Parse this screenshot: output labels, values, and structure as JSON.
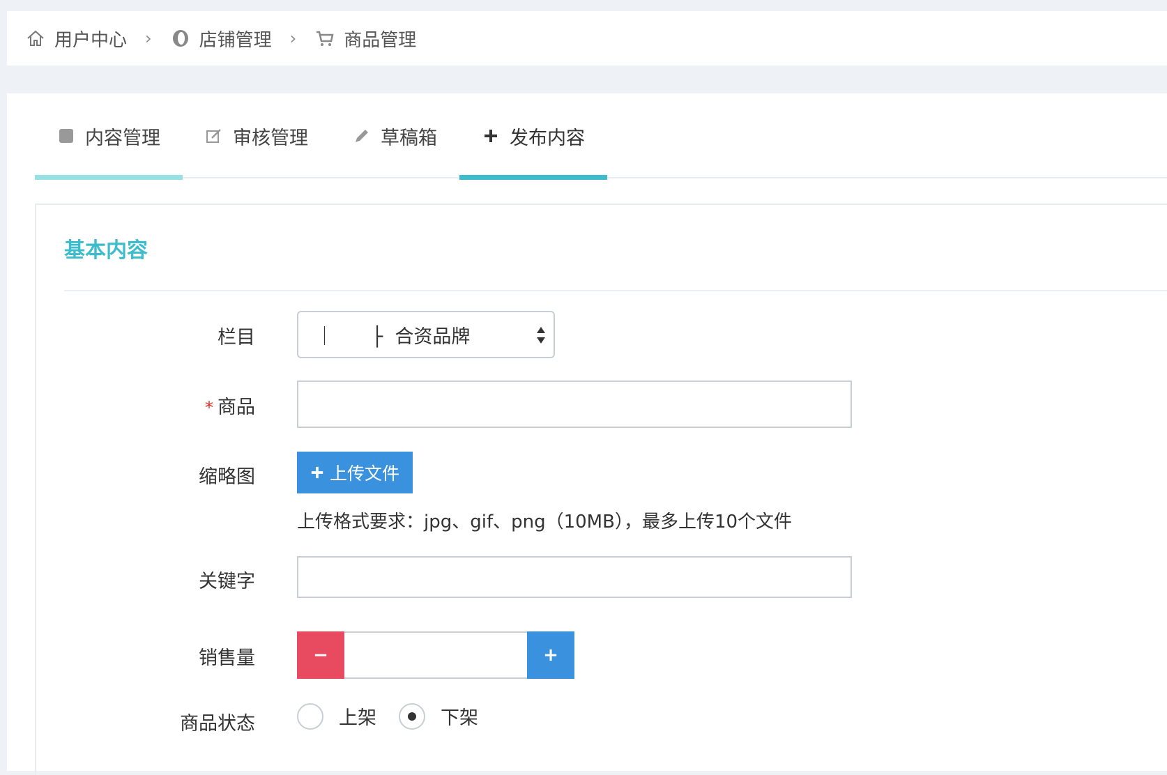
{
  "breadcrumb": {
    "items": [
      {
        "label": "用户中心",
        "icon": "home-icon"
      },
      {
        "label": "店铺管理",
        "icon": "store-icon"
      },
      {
        "label": "商品管理",
        "icon": "cart-icon"
      }
    ],
    "separator": "›"
  },
  "tabs": [
    {
      "label": "内容管理",
      "icon": "square-icon",
      "active": false
    },
    {
      "label": "审核管理",
      "icon": "edit-icon",
      "active": false
    },
    {
      "label": "草稿箱",
      "icon": "pencil-icon",
      "active": false
    },
    {
      "label": "发布内容",
      "icon": "plus-icon",
      "active": true
    }
  ],
  "form": {
    "section_title": "基本内容",
    "category": {
      "label": "栏目",
      "value": "｜　　├  合资品牌"
    },
    "product": {
      "label": "商品",
      "required_mark": "*",
      "value": ""
    },
    "thumbnail": {
      "label": "缩略图",
      "upload_label": "上传文件",
      "hint": "上传格式要求：jpg、gif、png（10MB），最多上传10个文件"
    },
    "keywords": {
      "label": "关键字",
      "value": ""
    },
    "sales": {
      "label": "销售量",
      "minus": "−",
      "plus": "+",
      "value": ""
    },
    "status": {
      "label": "商品状态",
      "options": [
        {
          "label": "上架",
          "selected": false
        },
        {
          "label": "下架",
          "selected": true
        }
      ]
    }
  },
  "colors": {
    "accent": "#3dbdcc",
    "accent_light": "#97e0e6",
    "primary": "#3a92de",
    "danger": "#e84a5f",
    "required": "#e0261e"
  }
}
